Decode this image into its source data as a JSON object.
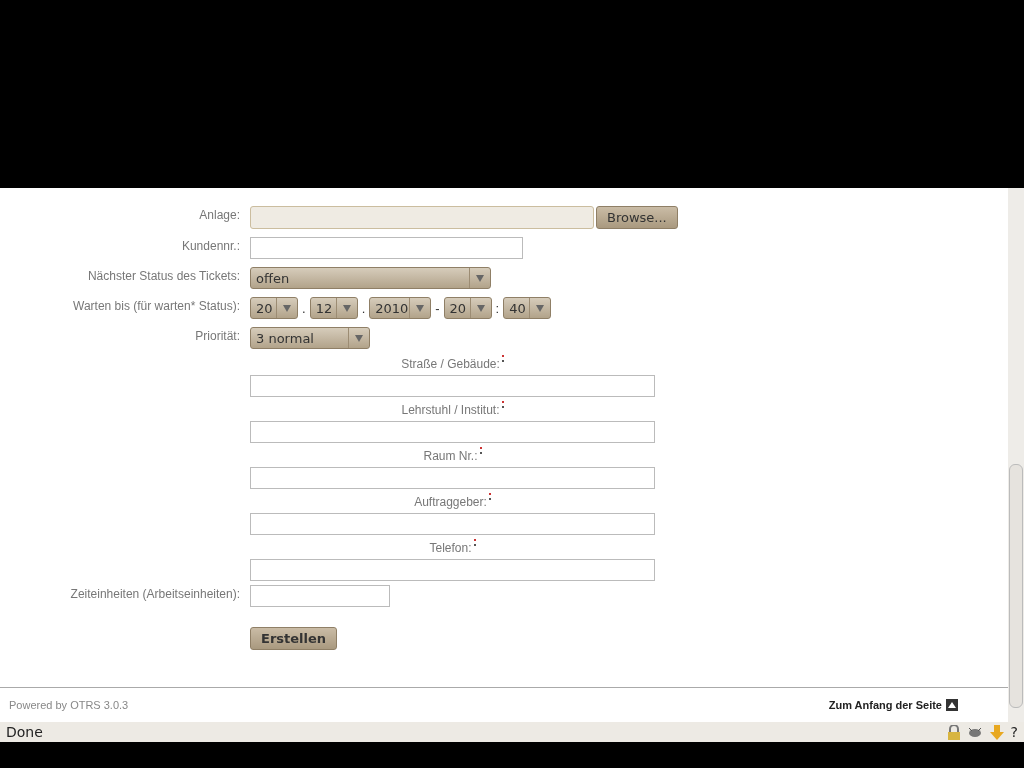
{
  "form": {
    "attachment": {
      "label": "Anlage:",
      "button": "Browse..."
    },
    "customer_no": {
      "label": "Kundennr.:"
    },
    "next_state": {
      "label": "Nächster Status des Tickets:",
      "value": "offen"
    },
    "pending_until": {
      "label": "Warten bis (für warten* Status):",
      "parts": [
        {
          "value": "20",
          "sep": "."
        },
        {
          "value": "12",
          "sep": "."
        },
        {
          "value": "2010",
          "sep": "-"
        },
        {
          "value": "20",
          "sep": ":"
        },
        {
          "value": "40"
        }
      ]
    },
    "priority": {
      "label": "Priorität:",
      "value": "3 normal"
    },
    "extra_fields": [
      {
        "label": "Straße / Gebäude:",
        "required": true
      },
      {
        "label": "Lehrstuhl / Institut:",
        "required": true
      },
      {
        "label": "Raum Nr.:",
        "required": true
      },
      {
        "label": "Auftraggeber:",
        "required": true
      },
      {
        "label": "Telefon:",
        "required": true
      }
    ],
    "time_units": {
      "label": "Zeiteinheiten (Arbeitseinheiten):"
    },
    "submit": "Erstellen"
  },
  "footer": {
    "powered_by": "Powered by OTRS 3.0.3",
    "top_link": "Zum Anfang der Seite"
  },
  "status_bar": {
    "text": "Done",
    "help": "?"
  }
}
